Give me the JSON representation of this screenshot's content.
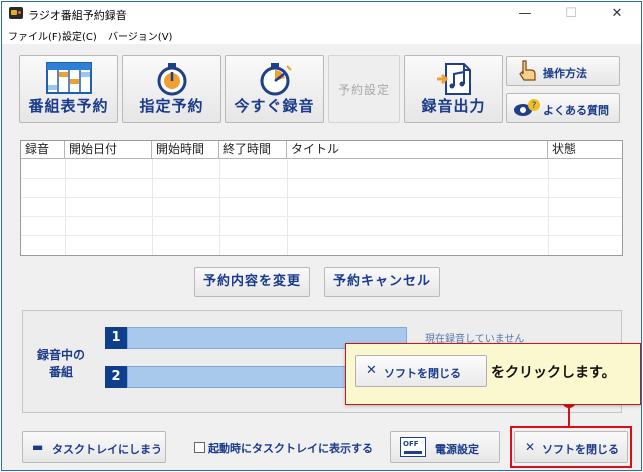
{
  "window": {
    "title": "ラジオ番組予約録音",
    "minimize": "—",
    "maximize": "☐",
    "close": "✕"
  },
  "menu": [
    "ファイル(F)",
    "設定(C)",
    "バージョン(V)"
  ],
  "toolbar": [
    {
      "label": "番組表予約",
      "icon": "program-table-icon",
      "enabled": true
    },
    {
      "label": "指定予約",
      "icon": "stopwatch-icon",
      "enabled": true
    },
    {
      "label": "今すぐ録音",
      "icon": "stopwatch-record-icon",
      "enabled": true
    },
    {
      "label": "予約設定",
      "icon": "",
      "enabled": false
    },
    {
      "label": "録音出力",
      "icon": "music-export-icon",
      "enabled": true
    }
  ],
  "side_buttons": {
    "howto": {
      "label": "操作方法",
      "icon": "pointing-hand-icon"
    },
    "faq": {
      "label": "よくある質問",
      "icon": "eye-question-icon"
    }
  },
  "table": {
    "columns": [
      "録音",
      "開始日付",
      "開始時間",
      "終了時間",
      "タイトル",
      "状態"
    ],
    "rows": []
  },
  "actions": {
    "change": "予約内容を変更",
    "cancel": "予約キャンセル"
  },
  "recording": {
    "label_line1": "録音中の",
    "label_line2": "番組",
    "slots": [
      {
        "number": "1",
        "status": "現在録音していません"
      },
      {
        "number": "2",
        "status": ""
      }
    ]
  },
  "bottom": {
    "tray_label": "タスクトレイにしまう",
    "tray_icon_char": "▬",
    "startup_label": "起動時にタスクトレイに表示する",
    "startup_checked": false,
    "power_label": "電源設定",
    "power_icon_text": "OFF",
    "close_label": "ソフトを閉じる",
    "close_icon_char": "✕"
  },
  "callout": {
    "button_label": "ソフトを閉じる",
    "button_icon_char": "✕",
    "text": "をクリックします。"
  },
  "colors": {
    "accent_text": "#1a3a8a",
    "highlight": "#d6101a",
    "callout_bg": "#fbf7cf",
    "slot_bar": "#a9c9ec",
    "slot_number_bg": "#0f3f8c"
  }
}
